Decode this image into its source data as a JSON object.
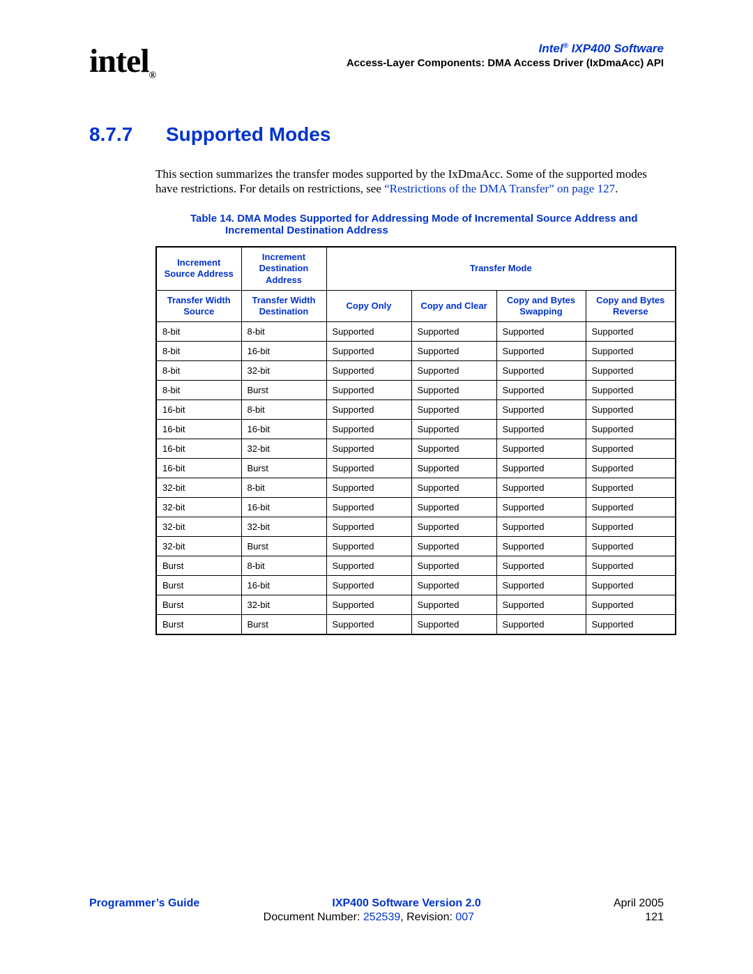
{
  "header": {
    "logo_text": "intel",
    "reg_mark": "®",
    "doc_title_prefix": "Intel",
    "doc_title_suffix": " IXP400 Software",
    "subtitle": "Access-Layer Components: DMA Access Driver (IxDmaAcc) API"
  },
  "section": {
    "number": "8.7.7",
    "title": "Supported Modes"
  },
  "body": {
    "para1_a": "This section summarizes the transfer modes supported by the IxDmaAcc. Some of the supported modes have restrictions. For details on restrictions, see ",
    "para1_link": "“Restrictions of the DMA Transfer” on page 127",
    "para1_b": "."
  },
  "table": {
    "caption": "Table 14.  DMA Modes Supported for Addressing Mode of Incremental Source Address and Incremental Destination Address",
    "head_r1_c1": "Increment Source Address",
    "head_r1_c2": "Increment Destination Address",
    "head_r1_c3": "Transfer Mode",
    "head_r2_c1": "Transfer Width Source",
    "head_r2_c2": "Transfer Width Destination",
    "head_r2_c3": "Copy Only",
    "head_r2_c4": "Copy and Clear",
    "head_r2_c5": "Copy and Bytes Swapping",
    "head_r2_c6": "Copy and Bytes Reverse",
    "rows": [
      {
        "c1": "8-bit",
        "c2": "8-bit",
        "c3": "Supported",
        "c4": "Supported",
        "c5": "Supported",
        "c6": "Supported"
      },
      {
        "c1": "8-bit",
        "c2": "16-bit",
        "c3": "Supported",
        "c4": "Supported",
        "c5": "Supported",
        "c6": "Supported"
      },
      {
        "c1": "8-bit",
        "c2": "32-bit",
        "c3": "Supported",
        "c4": "Supported",
        "c5": "Supported",
        "c6": "Supported"
      },
      {
        "c1": "8-bit",
        "c2": "Burst",
        "c3": "Supported",
        "c4": "Supported",
        "c5": "Supported",
        "c6": "Supported"
      },
      {
        "c1": "16-bit",
        "c2": "8-bit",
        "c3": "Supported",
        "c4": "Supported",
        "c5": "Supported",
        "c6": "Supported"
      },
      {
        "c1": "16-bit",
        "c2": "16-bit",
        "c3": "Supported",
        "c4": "Supported",
        "c5": "Supported",
        "c6": "Supported"
      },
      {
        "c1": "16-bit",
        "c2": "32-bit",
        "c3": "Supported",
        "c4": "Supported",
        "c5": "Supported",
        "c6": "Supported"
      },
      {
        "c1": "16-bit",
        "c2": "Burst",
        "c3": "Supported",
        "c4": "Supported",
        "c5": "Supported",
        "c6": "Supported"
      },
      {
        "c1": "32-bit",
        "c2": "8-bit",
        "c3": "Supported",
        "c4": "Supported",
        "c5": "Supported",
        "c6": "Supported"
      },
      {
        "c1": "32-bit",
        "c2": "16-bit",
        "c3": "Supported",
        "c4": "Supported",
        "c5": "Supported",
        "c6": "Supported"
      },
      {
        "c1": "32-bit",
        "c2": "32-bit",
        "c3": "Supported",
        "c4": "Supported",
        "c5": "Supported",
        "c6": "Supported"
      },
      {
        "c1": "32-bit",
        "c2": "Burst",
        "c3": "Supported",
        "c4": "Supported",
        "c5": "Supported",
        "c6": "Supported"
      },
      {
        "c1": "Burst",
        "c2": "8-bit",
        "c3": "Supported",
        "c4": "Supported",
        "c5": "Supported",
        "c6": "Supported"
      },
      {
        "c1": "Burst",
        "c2": "16-bit",
        "c3": "Supported",
        "c4": "Supported",
        "c5": "Supported",
        "c6": "Supported"
      },
      {
        "c1": "Burst",
        "c2": "32-bit",
        "c3": "Supported",
        "c4": "Supported",
        "c5": "Supported",
        "c6": "Supported"
      },
      {
        "c1": "Burst",
        "c2": "Burst",
        "c3": "Supported",
        "c4": "Supported",
        "c5": "Supported",
        "c6": "Supported"
      }
    ]
  },
  "footer": {
    "left": "Programmer’s Guide",
    "center": "IXP400 Software Version 2.0",
    "right": "April 2005",
    "row2_prefix": "Document Number: ",
    "docnum": "252539",
    "row2_mid": ", Revision: ",
    "revision": "007",
    "page": "121"
  }
}
